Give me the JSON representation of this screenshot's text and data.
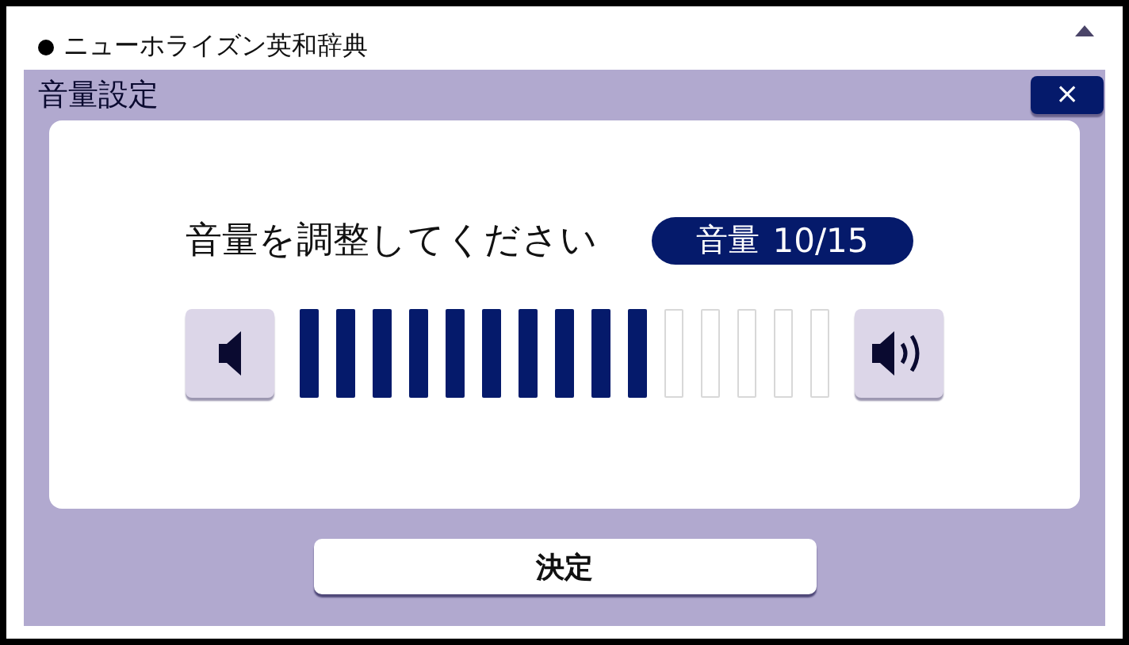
{
  "header": {
    "title": "ニューホライズン英和辞典"
  },
  "dialog": {
    "title": "音量設定",
    "close": "×",
    "prompt": "音量を調整してください",
    "badge": {
      "label": "音量",
      "value": "10/15"
    },
    "volume_segments": [
      {
        "filled": true
      },
      {
        "filled": true
      },
      {
        "filled": true
      },
      {
        "filled": true
      },
      {
        "filled": true
      },
      {
        "filled": true
      },
      {
        "filled": true
      },
      {
        "filled": true
      },
      {
        "filled": true
      },
      {
        "filled": true
      },
      {
        "filled": false
      },
      {
        "filled": false
      },
      {
        "filled": false
      },
      {
        "filled": false
      },
      {
        "filled": false
      }
    ],
    "confirm": "決定"
  }
}
